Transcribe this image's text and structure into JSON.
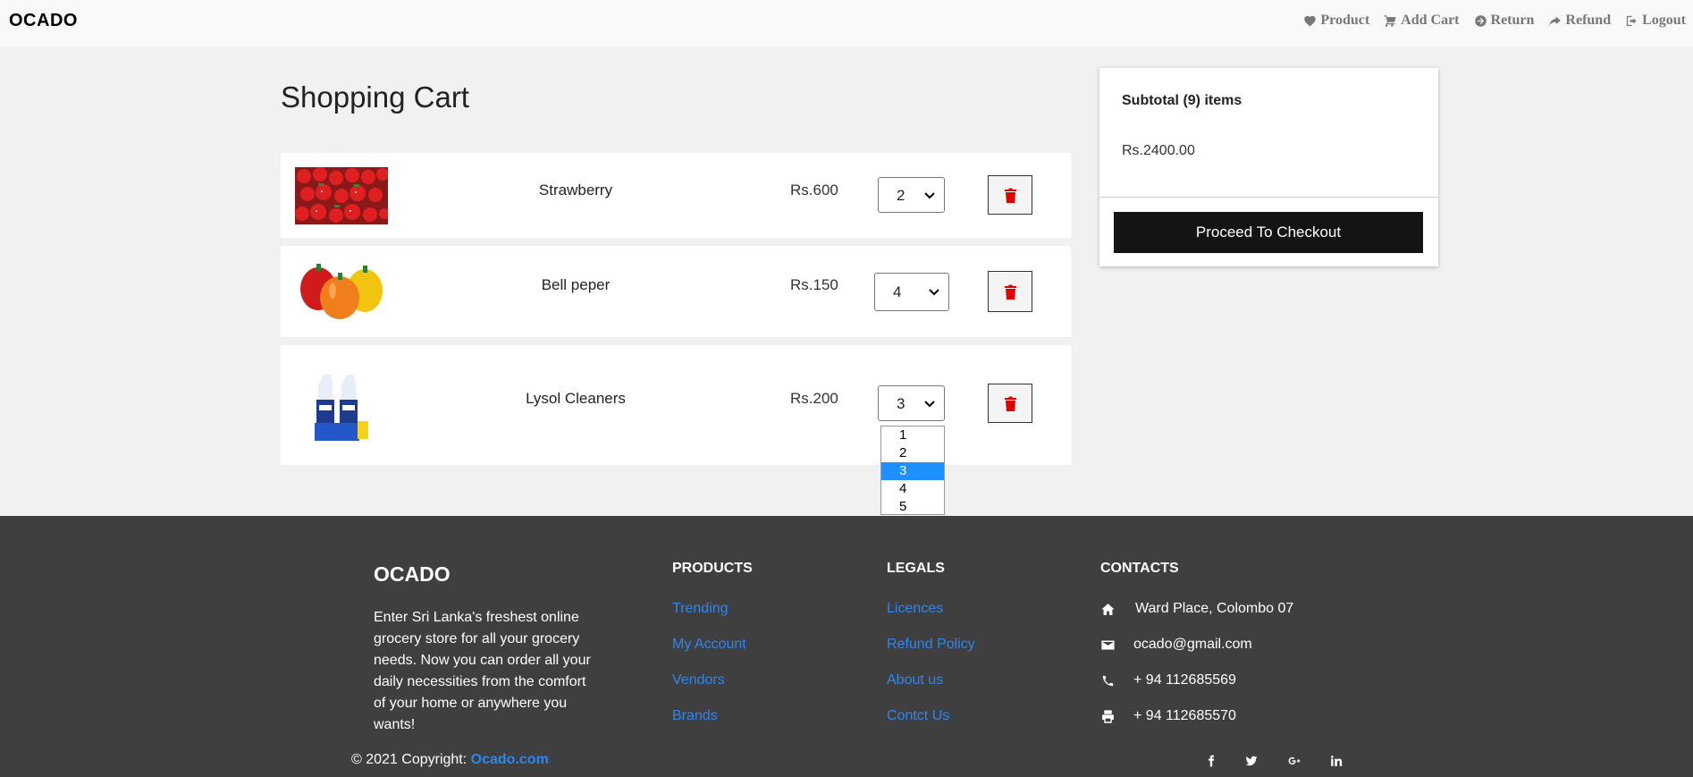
{
  "navbar": {
    "brand": "OCADO",
    "links": [
      {
        "label": "Product",
        "icon": "heart-icon"
      },
      {
        "label": "Add Cart",
        "icon": "cart-icon"
      },
      {
        "label": "Return",
        "icon": "arrow-circle-right-icon"
      },
      {
        "label": "Refund",
        "icon": "share-icon"
      },
      {
        "label": "Logout",
        "icon": "sign-out-icon"
      }
    ]
  },
  "cart": {
    "title": "Shopping Cart",
    "items": [
      {
        "name": "Strawberry",
        "price": "Rs.600",
        "qty": "2",
        "image": "strawberry-image"
      },
      {
        "name": "Bell peper",
        "price": "Rs.150",
        "qty": "4",
        "image": "bell-pepper-image"
      },
      {
        "name": "Lysol Cleaners",
        "price": "Rs.200",
        "qty": "3",
        "image": "lysol-cleaner-image"
      }
    ],
    "qty_options": [
      "1",
      "2",
      "3",
      "4",
      "5"
    ],
    "selected_option": "3"
  },
  "summary": {
    "title": "Subtotal (9) items",
    "amount": "Rs.2400.00",
    "checkout_label": "Proceed To Checkout"
  },
  "footer": {
    "brand": "OCADO",
    "description": "Enter Sri Lanka's freshest online grocery store for all your grocery needs. Now you can order all your daily necessities from the comfort of your home or anywhere you wants!",
    "products": {
      "heading": "PRODUCTS",
      "links": [
        "Trending",
        "My Account",
        "Vendors",
        "Brands"
      ]
    },
    "legals": {
      "heading": "LEGALS",
      "links": [
        "Licences",
        "Refund Policy",
        "About us",
        "Contct Us"
      ]
    },
    "contacts": {
      "heading": "CONTACTS",
      "items": [
        {
          "icon": "home-icon",
          "text": "Ward Place, Colombo 07"
        },
        {
          "icon": "envelope-icon",
          "text": "ocado@gmail.com"
        },
        {
          "icon": "phone-icon",
          "text": "+ 94 112685569"
        },
        {
          "icon": "print-icon",
          "text": "+ 94 112685570"
        }
      ]
    },
    "copyright_prefix": "© 2021 Copyright:",
    "copyright_link": "Ocado.com",
    "social": [
      "facebook-icon",
      "twitter-icon",
      "google-plus-icon",
      "linkedin-icon"
    ]
  },
  "colors": {
    "link": "#2e86ef",
    "delete_icon": "#e00000",
    "checkout_bg": "#141414",
    "footer_bg": "#3f3f3f",
    "dropdown_selected": "#1e90ff"
  }
}
